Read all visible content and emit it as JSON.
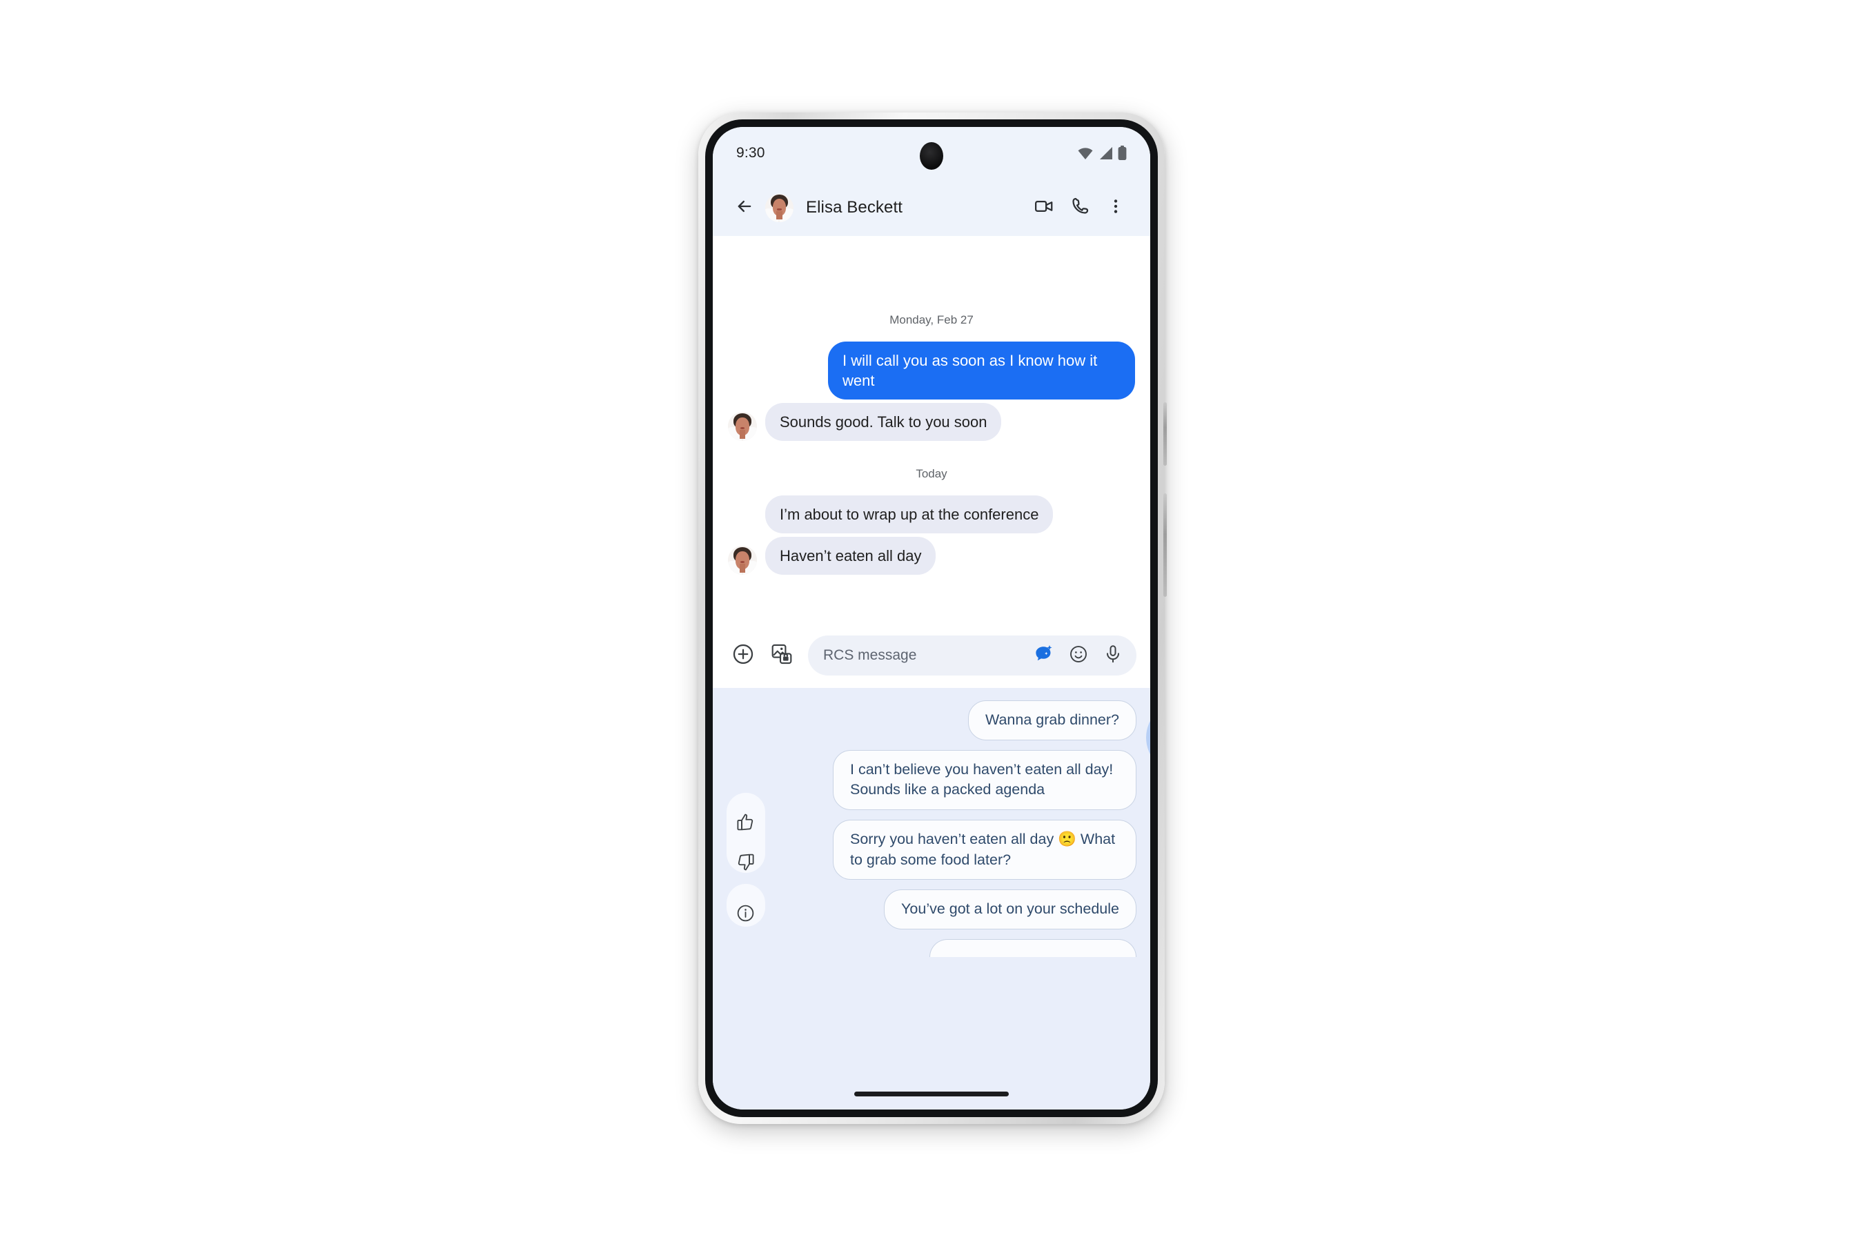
{
  "status_bar": {
    "time": "9:30",
    "icons": [
      "wifi-icon",
      "cellular-signal-icon",
      "battery-icon"
    ]
  },
  "header": {
    "back_icon": "back-arrow-icon",
    "avatar_alt": "Elisa Beckett",
    "title": "Elisa Beckett",
    "actions": [
      {
        "name": "video-call-icon",
        "label": "Video call"
      },
      {
        "name": "voice-call-icon",
        "label": "Call"
      },
      {
        "name": "overflow-menu-icon",
        "label": "More options"
      }
    ]
  },
  "conversation": {
    "dividers": {
      "past": "Monday, Feb 27",
      "today": "Today"
    },
    "messages": [
      {
        "id": "m1",
        "direction": "out",
        "text": "I will call you as soon as I know how it went"
      },
      {
        "id": "m2",
        "direction": "in",
        "text": "Sounds good. Talk to you soon",
        "avatar": true
      },
      {
        "id": "m3",
        "direction": "in",
        "text": "I’m about to wrap up at the conference",
        "avatar": false
      },
      {
        "id": "m4",
        "direction": "in",
        "text": "Haven’t eaten all day",
        "avatar": true
      }
    ]
  },
  "composer": {
    "attach_icon": "plus-circle-icon",
    "gallery_icon": "image-picker-icon",
    "placeholder": "RCS message",
    "magic_compose_icon": "magic-compose-sparkle-icon",
    "emoji_icon": "emoji-smiley-icon",
    "mic_icon": "microphone-icon"
  },
  "suggestions": {
    "feedback": [
      {
        "name": "thumbs-up-icon",
        "label": "Good suggestion"
      },
      {
        "name": "thumbs-down-icon",
        "label": "Bad suggestion"
      },
      {
        "name": "info-icon",
        "label": "About these suggestions"
      }
    ],
    "chips": [
      {
        "id": "c1",
        "text": "Wanna grab dinner?",
        "tapped": true
      },
      {
        "id": "c2",
        "text": "I can’t believe you haven’t eaten all day! Sounds like a packed agenda",
        "tapped": false
      },
      {
        "id": "c3",
        "text": "Sorry you haven’t eaten all day 🙁 What to grab some food later?",
        "tapped": false
      },
      {
        "id": "c4",
        "text": "You’ve got a lot on your schedule",
        "tapped": false
      }
    ]
  },
  "system_nav": {
    "gesture_bar": "home-gesture-bar"
  },
  "colors": {
    "sent_bubble": "#1b6ef3",
    "received_bubble": "#e8eaf4",
    "suggestion_panel": "#e9eefa",
    "chip_text": "#2f4a6b",
    "header_bg": "#eef3fb",
    "magic_blue": "#1a6fe0"
  }
}
